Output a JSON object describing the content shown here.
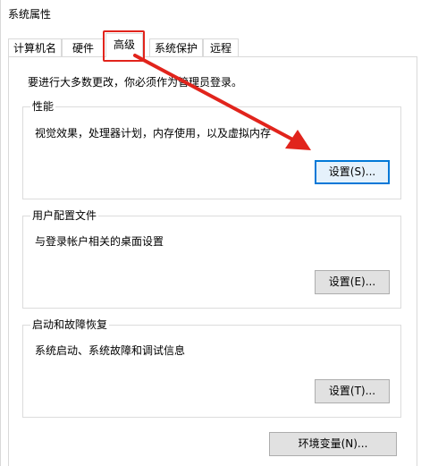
{
  "window": {
    "title": "系统属性"
  },
  "tabs": [
    {
      "label": "计算机名"
    },
    {
      "label": "硬件"
    },
    {
      "label": "高级"
    },
    {
      "label": "系统保护"
    },
    {
      "label": "远程"
    }
  ],
  "notice": "要进行大多数更改，你必须作为管理员登录。",
  "performance": {
    "title": "性能",
    "desc": "视觉效果，处理器计划，内存使用，以及虚拟内存",
    "button": "设置(S)..."
  },
  "user_profiles": {
    "title": "用户配置文件",
    "desc": "与登录帐户相关的桌面设置",
    "button": "设置(E)..."
  },
  "startup_recovery": {
    "title": "启动和故障恢复",
    "desc": "系统启动、系统故障和调试信息",
    "button": "设置(T)..."
  },
  "env_button": "环境变量(N)...",
  "colors": {
    "highlight": "#e1241c",
    "arrow": "#e1241c",
    "focus_border": "#0078d7"
  }
}
